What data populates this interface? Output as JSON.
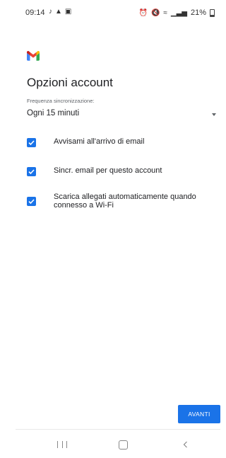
{
  "status_bar": {
    "time": "09:14",
    "left_icons": [
      "bell-icon",
      "alert-icon",
      "image-icon"
    ],
    "battery": "21%"
  },
  "brand": {
    "logo": "gmail-logo",
    "colors": {
      "red": "#ea4335",
      "blue": "#4285f4",
      "green": "#34a853",
      "yellow": "#fbbc04"
    }
  },
  "page": {
    "title": "Opzioni account",
    "frequency_label": "Frequenza sincronizzazione:",
    "frequency_value": "Ogni 15 minuti"
  },
  "options": [
    {
      "label": "Avvisami all'arrivo di email",
      "checked": true
    },
    {
      "label": "Sincr. email per questo account",
      "checked": true
    },
    {
      "label": "Scarica allegati automaticamente quando connesso a Wi-Fi",
      "checked": true
    }
  ],
  "actions": {
    "next_label": "AVANTI"
  },
  "nav": {
    "recent": "recent-apps-icon",
    "home": "home-icon",
    "back": "back-icon"
  },
  "colors": {
    "accent": "#1a73e8"
  }
}
